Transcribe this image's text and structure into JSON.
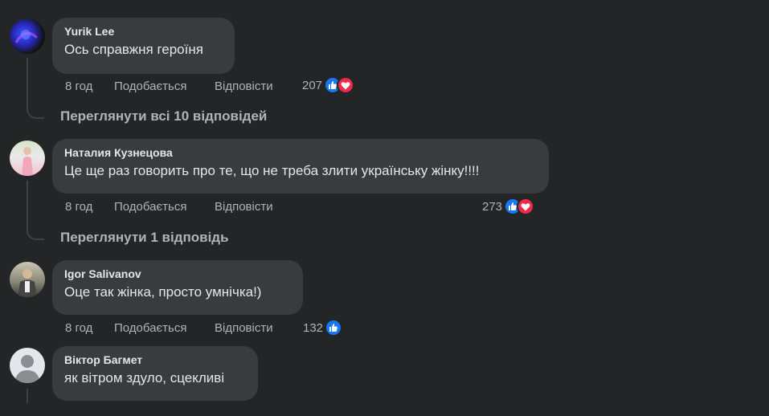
{
  "comments": [
    {
      "author": "Yurik Lee",
      "text": "Ось справжня героїня",
      "time": "8 год",
      "like_label": "Подобається",
      "reply_label": "Відповісти",
      "reaction_count": "207",
      "reactions": [
        "like-icon",
        "love-icon"
      ],
      "view_replies": "Переглянути всі 10 відповідей"
    },
    {
      "author": "Наталия Кузнецова",
      "text": "Це ще раз говорить про те, що не треба злити українську жінку!!!!",
      "time": "8 год",
      "like_label": "Подобається",
      "reply_label": "Відповісти",
      "reaction_count": "273",
      "reactions": [
        "like-icon",
        "love-icon"
      ],
      "view_replies": "Переглянути 1 відповідь"
    },
    {
      "author": "Igor Salivanov",
      "text": "Оце так жінка, просто умнічка!)",
      "time": "8 год",
      "like_label": "Подобається",
      "reply_label": "Відповісти",
      "reaction_count": "132",
      "reactions": [
        "like-icon"
      ]
    },
    {
      "author": "Віктор Багмет",
      "text": "як вітром здуло, сцекливі"
    }
  ],
  "colors": {
    "background": "#242526",
    "bubble": "#3a3b3c",
    "like": "#1877f2",
    "love": "#f0284a",
    "secondary_text": "#b0b3b8"
  }
}
